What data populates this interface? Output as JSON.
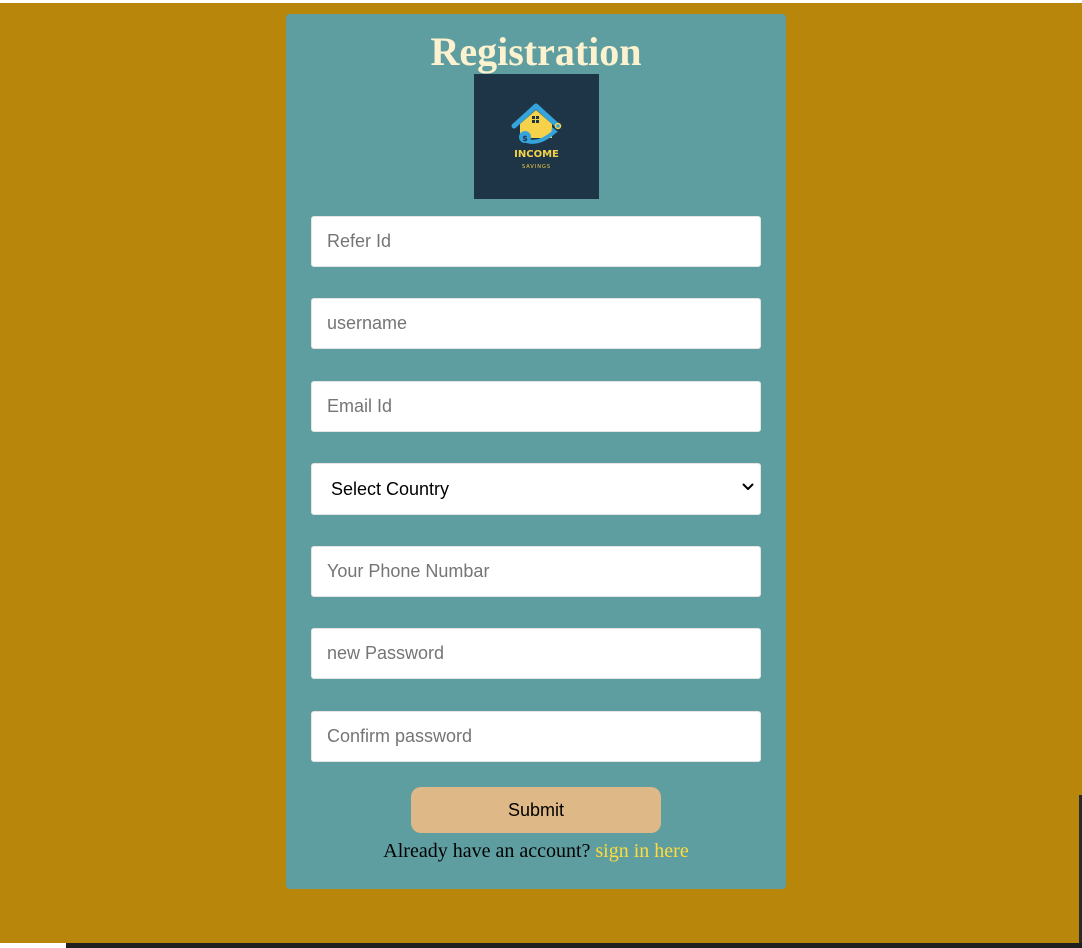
{
  "form": {
    "title": "Registration",
    "logo": {
      "brand": "INCOME",
      "tagline": "SAVINGS"
    },
    "fields": {
      "refer_id": {
        "placeholder": "Refer Id",
        "value": ""
      },
      "username": {
        "placeholder": "username",
        "value": ""
      },
      "email": {
        "placeholder": "Email Id",
        "value": ""
      },
      "country": {
        "selected": "Select Country"
      },
      "phone": {
        "placeholder": "Your Phone Numbar",
        "value": ""
      },
      "new_password": {
        "placeholder": "new Password",
        "value": ""
      },
      "confirm_password": {
        "placeholder": "Confirm password",
        "value": ""
      }
    },
    "submit_label": "Submit",
    "signin_prompt": "Already have an account?",
    "signin_link": "sign in here"
  },
  "colors": {
    "page_background": "#b8860b",
    "card_background": "#5f9ea0",
    "title_color": "#fdf2cf",
    "logo_background": "#1e3547",
    "submit_background": "#deb887",
    "link_color": "#ffdb3b"
  }
}
